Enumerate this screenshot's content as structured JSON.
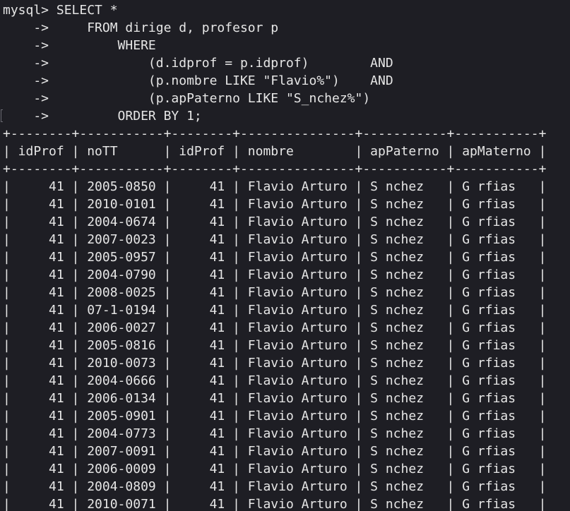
{
  "terminal": {
    "lines": [
      "mysql> SELECT *",
      "    ->     FROM dirige d, profesor p",
      "    ->         WHERE",
      "    ->             (d.idprof = p.idprof)        AND",
      "    ->             (p.nombre LIKE \"Flavio%\")    AND",
      "    ->             (p.apPaterno LIKE \"S_nchez%\")",
      "    ->         ORDER BY 1;",
      "+--------+-----------+--------+---------------+-----------+-----------+",
      "| idProf | noTT      | idProf | nombre        | apPaterno | apMaterno |",
      "+--------+-----------+--------+---------------+-----------+-----------+",
      "|     41 | 2005-0850 |     41 | Flavio Arturo | S nchez   | G rfias   |",
      "|     41 | 2010-0101 |     41 | Flavio Arturo | S nchez   | G rfias   |",
      "|     41 | 2004-0674 |     41 | Flavio Arturo | S nchez   | G rfias   |",
      "|     41 | 2007-0023 |     41 | Flavio Arturo | S nchez   | G rfias   |",
      "|     41 | 2005-0957 |     41 | Flavio Arturo | S nchez   | G rfias   |",
      "|     41 | 2004-0790 |     41 | Flavio Arturo | S nchez   | G rfias   |",
      "|     41 | 2008-0025 |     41 | Flavio Arturo | S nchez   | G rfias   |",
      "|     41 | 07-1-0194 |     41 | Flavio Arturo | S nchez   | G rfias   |",
      "|     41 | 2006-0027 |     41 | Flavio Arturo | S nchez   | G rfias   |",
      "|     41 | 2005-0816 |     41 | Flavio Arturo | S nchez   | G rfias   |",
      "|     41 | 2010-0073 |     41 | Flavio Arturo | S nchez   | G rfias   |",
      "|     41 | 2004-0666 |     41 | Flavio Arturo | S nchez   | G rfias   |",
      "|     41 | 2006-0134 |     41 | Flavio Arturo | S nchez   | G rfias   |",
      "|     41 | 2005-0901 |     41 | Flavio Arturo | S nchez   | G rfias   |",
      "|     41 | 2004-0773 |     41 | Flavio Arturo | S nchez   | G rfias   |",
      "|     41 | 2007-0091 |     41 | Flavio Arturo | S nchez   | G rfias   |",
      "|     41 | 2006-0009 |     41 | Flavio Arturo | S nchez   | G rfias   |",
      "|     41 | 2004-0809 |     41 | Flavio Arturo | S nchez   | G rfias   |",
      "|     41 | 2010-0071 |     41 | Flavio Arturo | S nchez   | G rfias   |"
    ]
  },
  "colors": {
    "background": "#1e1e24",
    "text": "#e6e6e6"
  }
}
